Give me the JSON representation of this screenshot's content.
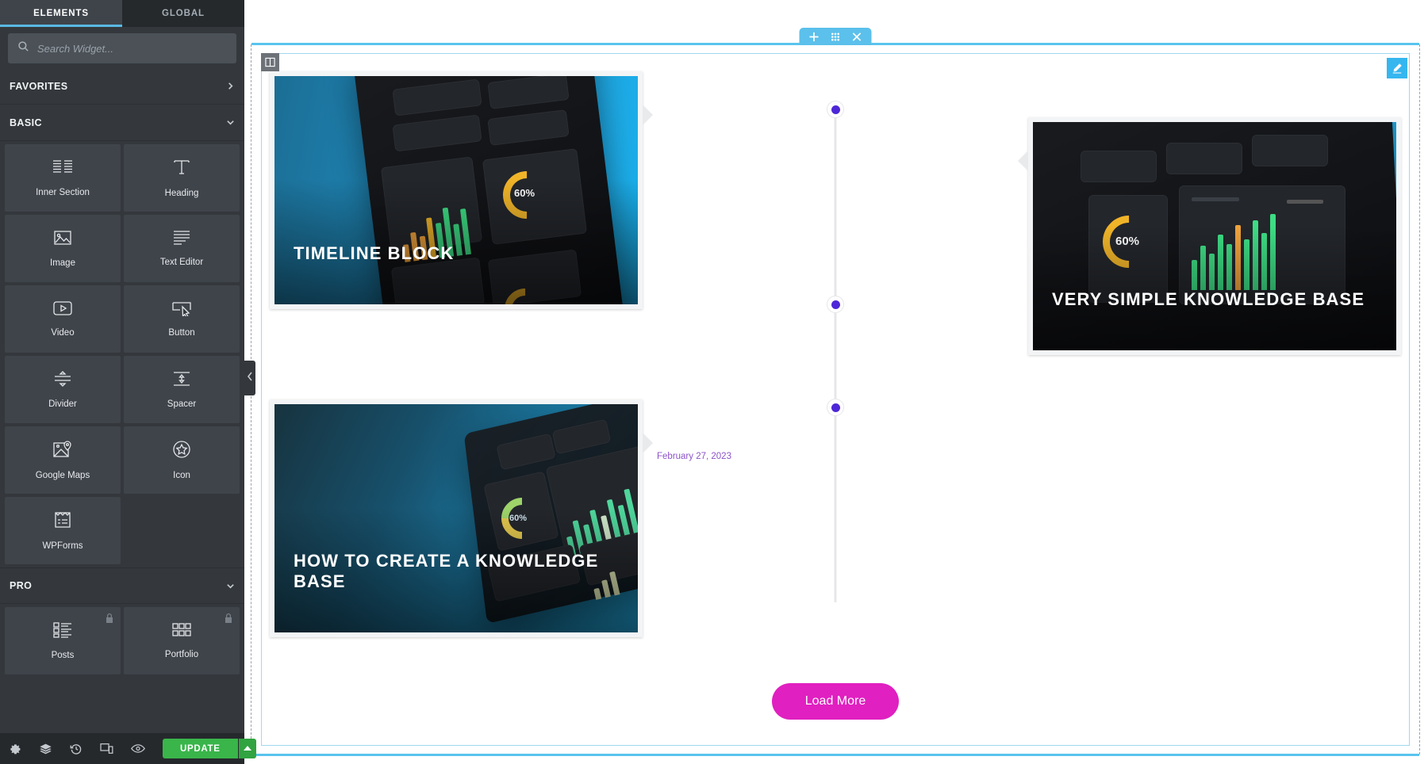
{
  "panel": {
    "tabs": [
      {
        "label": "ELEMENTS",
        "active": true
      },
      {
        "label": "GLOBAL",
        "active": false
      }
    ],
    "search": {
      "placeholder": "Search Widget...",
      "value": "",
      "icon": "search-icon"
    },
    "sections": [
      {
        "label": "FAVORITES",
        "state": "collapsed",
        "chevron": "chevron-right-icon"
      },
      {
        "label": "BASIC",
        "state": "expanded",
        "chevron": "chevron-down-icon"
      },
      {
        "label": "PRO",
        "state": "expanded",
        "chevron": "chevron-down-icon"
      }
    ],
    "basic_widgets": [
      {
        "label": "Inner Section",
        "icon": "inner-section-icon",
        "locked": false
      },
      {
        "label": "Heading",
        "icon": "heading-icon",
        "locked": false
      },
      {
        "label": "Image",
        "icon": "image-icon",
        "locked": false
      },
      {
        "label": "Text Editor",
        "icon": "text-editor-icon",
        "locked": false
      },
      {
        "label": "Video",
        "icon": "video-icon",
        "locked": false
      },
      {
        "label": "Button",
        "icon": "button-icon",
        "locked": false
      },
      {
        "label": "Divider",
        "icon": "divider-icon",
        "locked": false
      },
      {
        "label": "Spacer",
        "icon": "spacer-icon",
        "locked": false
      },
      {
        "label": "Google Maps",
        "icon": "google-maps-icon",
        "locked": false
      },
      {
        "label": "Icon",
        "icon": "star-icon",
        "locked": false
      },
      {
        "label": "WPForms",
        "icon": "wpforms-icon",
        "locked": false
      }
    ],
    "pro_widgets": [
      {
        "label": "Posts",
        "icon": "posts-icon",
        "locked": true
      },
      {
        "label": "Portfolio",
        "icon": "portfolio-icon",
        "locked": true
      }
    ],
    "footer": {
      "icons": [
        {
          "name": "settings-gear-icon",
          "title": "Settings"
        },
        {
          "name": "layers-navigator-icon",
          "title": "Navigator"
        },
        {
          "name": "history-icon",
          "title": "History"
        },
        {
          "name": "responsive-mode-icon",
          "title": "Responsive Mode"
        },
        {
          "name": "preview-eye-icon",
          "title": "Preview Changes"
        }
      ],
      "update_label": "UPDATE",
      "update_color": "#39b54a",
      "caret_icon": "caret-up-icon"
    },
    "collapse_handle_icon": "chevron-left-icon"
  },
  "canvas": {
    "section_tab": {
      "add_icon": "plus-icon",
      "drag_icon": "dots-grid-icon",
      "close_icon": "close-x-icon",
      "color": "#5bc0eb"
    },
    "column_handle_icon": "column-handle-icon",
    "edit_icon": "pencil-edit-icon",
    "timeline": {
      "dot_color": "#4d26d8",
      "line_color": "#e7e7ea",
      "items": [
        {
          "title": "TIMELINE BLOCK",
          "side": "left",
          "date": ""
        },
        {
          "title": "VERY SIMPLE KNOWLEDGE BASE",
          "side": "right",
          "date": ""
        },
        {
          "title": "HOW TO CREATE A KNOWLEDGE BASE",
          "side": "left",
          "date": "February 27, 2023"
        }
      ]
    },
    "load_more": {
      "label": "Load More",
      "color": "#e020c0"
    }
  }
}
